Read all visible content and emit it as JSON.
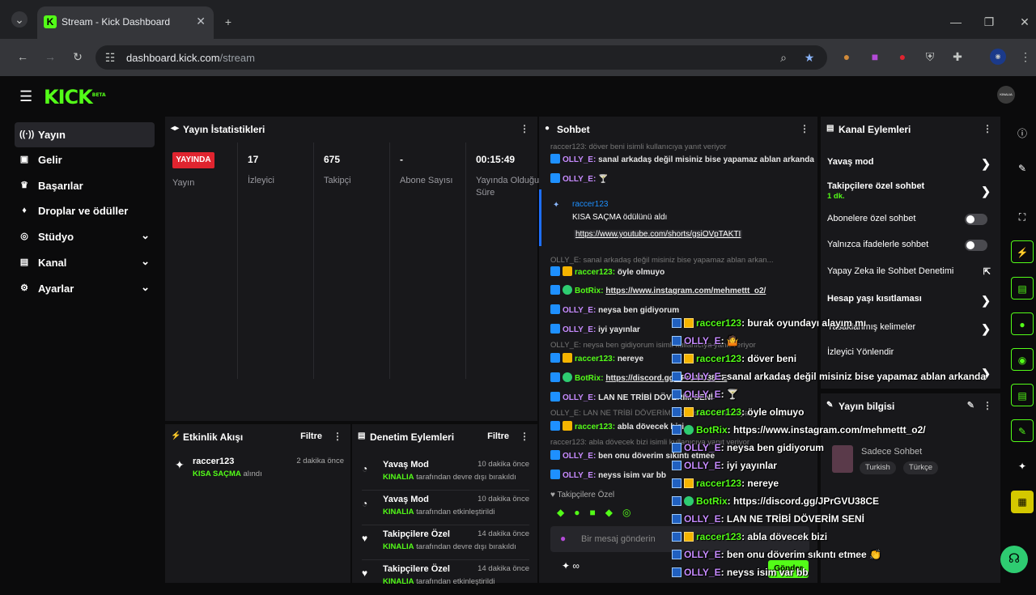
{
  "browser": {
    "tab_title": "Stream - Kick Dashboard",
    "url_domain": "dashboard.kick.com",
    "url_path": "/stream"
  },
  "logo": {
    "text": "KICK",
    "beta": "BETA"
  },
  "avatar_text": "KINALIA",
  "sidebar": {
    "items": [
      {
        "label": "Yayın",
        "icon": "broadcast-icon"
      },
      {
        "label": "Gelir",
        "icon": "wallet-icon"
      },
      {
        "label": "Başarılar",
        "icon": "trophy-icon"
      },
      {
        "label": "Droplar ve ödüller",
        "icon": "gift-icon"
      },
      {
        "label": "Stüdyo",
        "icon": "studio-icon"
      },
      {
        "label": "Kanal",
        "icon": "channel-icon"
      },
      {
        "label": "Ayarlar",
        "icon": "settings-icon"
      }
    ]
  },
  "stats": {
    "title": "Yayın İstatistikleri",
    "live_badge": "YAYINDA",
    "live_label": "Yayın",
    "viewers_value": "17",
    "viewers_label": "İzleyici",
    "followers_value": "675",
    "followers_label": "Takipçi",
    "subs_value": "-",
    "subs_label": "Abone Sayısı",
    "duration_value": "00:15:49",
    "duration_label": "Yayında Olduğu Süre"
  },
  "activity": {
    "title": "Etkinlik Akışı",
    "filter": "Filtre",
    "items": [
      {
        "user": "raccer123",
        "action": "KISA SAÇMA",
        "suffix": "alındı",
        "time": "2 dakika önce"
      }
    ]
  },
  "moderation": {
    "title": "Denetim Eylemleri",
    "filter": "Filtre",
    "items": [
      {
        "title": "Yavaş Mod",
        "user": "KINALIA",
        "desc": "tarafından devre dışı bırakıldı",
        "time": "10 dakika önce"
      },
      {
        "title": "Yavaş Mod",
        "user": "KINALIA",
        "desc": "tarafından etkinleştirildi",
        "time": "10 dakika önce"
      },
      {
        "title": "Takipçilere Özel",
        "user": "KINALIA",
        "desc": "tarafından devre dışı bırakıldı",
        "time": "14 dakika önce"
      },
      {
        "title": "Takipçilere Özel",
        "user": "KINALIA",
        "desc": "tarafından etkinleştirildi",
        "time": "14 dakika önce"
      }
    ]
  },
  "chat": {
    "title": "Sohbet",
    "reply1": "raccer123: döver beni isimli kullanıcıya yanıt veriyor",
    "lines": [
      {
        "user": "OLLY_E:",
        "text": "sanal arkadaş değil misiniz bise yapamaz ablan arkanda"
      },
      {
        "user": "OLLY_E:",
        "text": "🍸"
      }
    ],
    "reward_user": "raccer123",
    "reward_text": "KISA SAÇMA ödülünü aldı",
    "reward_link": "https://www.youtube.com/shorts/gsiOVpTAKTI",
    "reply2": "OLLY_E: sanal arkadaş değil misiniz bise yapamaz ablan arkan...",
    "lines2": [
      {
        "user": "raccer123:",
        "text": "öyle olmuyo",
        "cls": "u2"
      },
      {
        "user": "BotRix:",
        "text": "https://www.instagram.com/mehmettt_o2/",
        "cls": "u2"
      },
      {
        "user": "OLLY_E:",
        "text": "neysa ben gidiyorum",
        "cls": "u1"
      },
      {
        "user": "OLLY_E:",
        "text": "iyi yayınlar",
        "cls": "u1"
      }
    ],
    "reply3": "OLLY_E: neysa ben gidiyorum isimli kullanıcıya yanıt veriyor",
    "lines3": [
      {
        "user": "raccer123:",
        "text": "nereye",
        "cls": "u2"
      },
      {
        "user": "BotRix:",
        "text": "https://discord.gg/JPrGVU38CE",
        "cls": "u2"
      },
      {
        "user": "OLLY_E:",
        "text": "LAN NE TRİBİ DÖVERİM SENİ",
        "cls": "u1"
      }
    ],
    "reply4": "OLLY_E: LAN NE TRİBİ DÖVERİM SENİ isimli kullanıcıya yanıt veriyor",
    "line_abla": {
      "user": "raccer123:",
      "text": "abla dövecek bizi"
    },
    "reply5": "raccer123: abla dövecek bizi isimli kullanıcıya yanıt veriyor",
    "line_onu": {
      "user": "OLLY_E:",
      "text": "ben onu döverim sıkıntı etmee"
    },
    "line_ney": {
      "user": "OLLY_E:",
      "text": "neyss isim var bb"
    },
    "followers_only": "Takipçilere Özel",
    "input_placeholder": "Bir mesaj gönderin",
    "send_label": "Gönder"
  },
  "actions": {
    "title": "Kanal Eylemleri",
    "slow_mode": "Yavaş mod",
    "followers_chat": "Takipçilere özel sohbet",
    "followers_chat_value": "1 dk.",
    "subs_chat": "Abonelere özel sohbet",
    "emote_chat": "Yalnızca ifadelerle sohbet",
    "ai_mod": "Yapay Zeka ile Sohbet Denetimi",
    "age_restrict": "Hesap yaşı kısıtlaması",
    "banned_words": "Yasaklanmış kelimeler",
    "redirect": "İzleyici Yönlendir"
  },
  "stream_info": {
    "title": "Yayın bilgisi",
    "stream_title": "Sadece Sohbet",
    "tags": [
      "Turkish",
      "Türkçe"
    ]
  },
  "overlay": [
    {
      "badge": "yb",
      "user": "raccer123",
      "cls": "u2",
      "text": ": burak oyundayı alayım mı"
    },
    {
      "badge": "b",
      "user": "OLLY_E",
      "cls": "u1",
      "text": ": 🤷"
    },
    {
      "badge": "yb",
      "user": "raccer123",
      "cls": "u2",
      "text": ": döver beni"
    },
    {
      "badge": "b",
      "user": "OLLY_E",
      "cls": "u1",
      "text": ": sanal arkadaş değil misiniz bise yapamaz ablan arkanda"
    },
    {
      "badge": "b",
      "user": "OLLY_E",
      "cls": "u1",
      "text": ": 🍸"
    },
    {
      "badge": "yb",
      "user": "raccer123",
      "cls": "u2",
      "text": ": öyle olmuyo"
    },
    {
      "badge": "gb",
      "user": "BotRix",
      "cls": "u2",
      "text": ": https://www.instagram.com/mehmettt_o2/"
    },
    {
      "badge": "b",
      "user": "OLLY_E",
      "cls": "u1",
      "text": ": neysa ben gidiyorum"
    },
    {
      "badge": "b",
      "user": "OLLY_E",
      "cls": "u1",
      "text": ": iyi yayınlar"
    },
    {
      "badge": "yb",
      "user": "raccer123",
      "cls": "u2",
      "text": ": nereye"
    },
    {
      "badge": "gb",
      "user": "BotRix",
      "cls": "u2",
      "text": ": https://discord.gg/JPrGVU38CE"
    },
    {
      "badge": "b",
      "user": "OLLY_E",
      "cls": "u1",
      "text": ": LAN NE TRİBİ DÖVERİM SENİ"
    },
    {
      "badge": "yb",
      "user": "raccer123",
      "cls": "u2",
      "text": ": abla dövecek bizi"
    },
    {
      "badge": "b",
      "user": "OLLY_E",
      "cls": "u1",
      "text": ": ben onu döverim sıkıntı etmee 👏"
    },
    {
      "badge": "b",
      "user": "OLLY_E",
      "cls": "u1",
      "text": ": neyss isim var bb"
    }
  ],
  "colors": {
    "brand": "#53fc18",
    "live": "#e0242f",
    "panel": "#18181b",
    "username_purple": "#c78bff"
  }
}
